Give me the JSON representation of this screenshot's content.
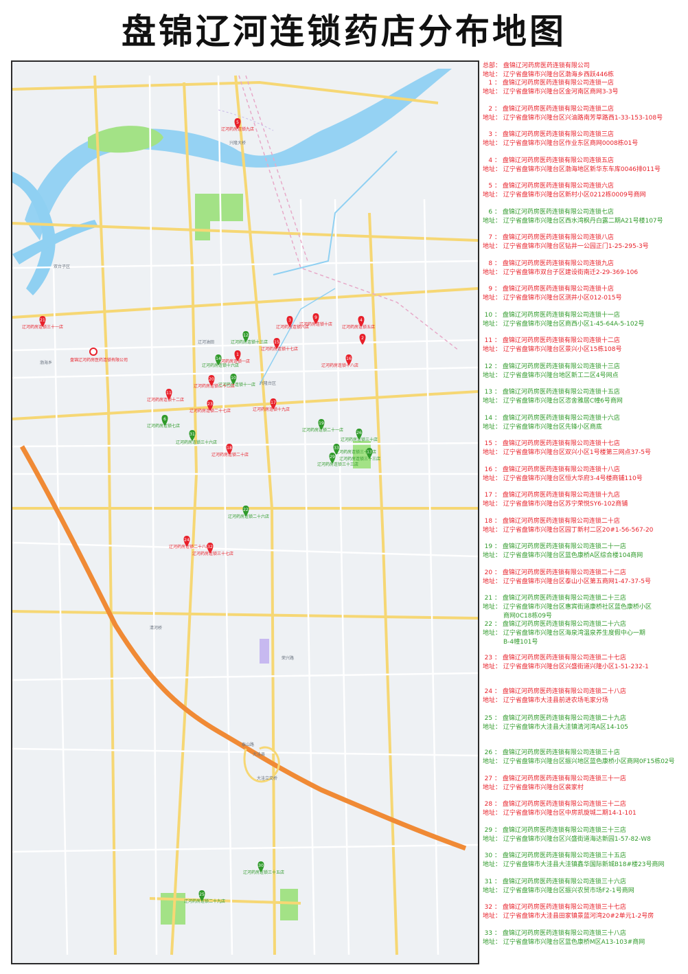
{
  "title": "盘锦辽河连锁药店分布地图",
  "colors": {
    "red": "#e8202a",
    "green": "#2f9a2a",
    "water": "#7fc8ee",
    "park": "#9fe07a",
    "road_yellow": "#f6d774",
    "highway": "#f08a35"
  },
  "addr_prefix": "地址：",
  "legend": [
    {
      "num": "总部",
      "company": "盘锦辽河药房医药连锁有限公司",
      "address": "辽宁省盘锦市兴隆台区渤海乡西跃446栋",
      "color": "red"
    },
    {
      "num": "1",
      "company": "盘锦辽河药房医药连锁有限公司连锁一店",
      "address": "辽宁省盘锦市兴隆台区金河南区商网3-3号",
      "color": "red"
    },
    {
      "num": "2",
      "company": "盘锦辽河药房医药连锁有限公司连锁二店",
      "address": "辽宁省盘锦市兴隆台区兴油路南芳草路西1-33-153-108号",
      "color": "red"
    },
    {
      "num": "3",
      "company": "盘锦辽河药房医药连锁有限公司连锁三店",
      "address": "辽宁省盘锦市兴隆台区作业东区商网0008栋01号",
      "color": "red"
    },
    {
      "num": "4",
      "company": "盘锦辽河药房医药连锁有限公司连锁五店",
      "address": "辽宁省盘锦市兴隆台区渤海地区新华东车库0046排011号",
      "color": "red"
    },
    {
      "num": "5",
      "company": "盘锦辽河药房医药连锁有限公司连锁六店",
      "address": "辽宁省盘锦市兴隆台区新村小区0212栋0009号商网",
      "color": "red"
    },
    {
      "num": "6",
      "company": "盘锦辽河药房医药连锁有限公司连锁七店",
      "address": "辽宁省盘锦市兴隆台区西水湾枫丹白露二期A21号楼107号",
      "color": "green"
    },
    {
      "num": "7",
      "company": "盘锦辽河药房医药连锁有限公司连锁八店",
      "address": "辽宁省盘锦市兴隆台区钻井一公园正门1-25-295-3号",
      "color": "red"
    },
    {
      "num": "8",
      "company": "盘锦辽河药房医药连锁有限公司连锁九店",
      "address": "辽宁省盘锦市双台子区建设街南迁2-29-369-106",
      "color": "red"
    },
    {
      "num": "9",
      "company": "盘锦辽河药房医药连锁有限公司连锁十店",
      "address": "辽宁省盘锦市兴隆台区测井小区012-015号",
      "color": "red"
    },
    {
      "num": "10",
      "company": "盘锦辽河药房医药连锁有限公司连锁十一店",
      "address": "辽宁省盘锦市兴隆台区商西小区1-45-64A-5-102号",
      "color": "green"
    },
    {
      "num": "11",
      "company": "盘锦辽河药房医药连锁有限公司连锁十二店",
      "address": "辽宁省盘锦市兴隆台区景兴小区15栋108号",
      "color": "red"
    },
    {
      "num": "12",
      "company": "盘锦辽河药房医药连锁有限公司连锁十三店",
      "address": "辽宁省盘锦市兴隆台地区新工二区4号网点",
      "color": "green"
    },
    {
      "num": "13",
      "company": "盘锦辽河药房医药连锁有限公司连锁十五店",
      "address": "辽宁省盘锦市兴隆台区恣舍雅居C幢6号商网",
      "color": "green"
    },
    {
      "num": "14",
      "company": "盘锦辽河药房医药连锁有限公司连锁十六店",
      "address": "辽宁省盘锦市兴隆台区先锋小区商底",
      "color": "green"
    },
    {
      "num": "15",
      "company": "盘锦辽河药房医药连锁有限公司连锁十七店",
      "address": "辽宁省盘锦市兴隆台区双兴小区1号楼第三网点37-5号",
      "color": "red"
    },
    {
      "num": "16",
      "company": "盘锦辽河药房医药连锁有限公司连锁十八店",
      "address": "辽宁省盘锦市兴隆台区恒大华府3-4号楼商铺110号",
      "color": "red"
    },
    {
      "num": "17",
      "company": "盘锦辽河药房医药连锁有限公司连锁十九店",
      "address": "辽宁省盘锦市兴隆台区苏宁荣悦SY6-102商铺",
      "color": "red"
    },
    {
      "num": "18",
      "company": "盘锦辽河药房医药连锁有限公司连锁二十店",
      "address": "辽宁省盘锦市兴隆台区园丁新村二区20#1-56-567-20",
      "color": "red"
    },
    {
      "num": "19",
      "company": "盘锦辽河药房医药连锁有限公司连锁二十一店",
      "address": "辽宁省盘锦市兴隆台区蓝色康桥A区综合楼104商网",
      "color": "green"
    },
    {
      "num": "20",
      "company": "盘锦辽河药房医药连锁有限公司连锁二十二店",
      "address": "辽宁省盘锦市兴隆台区泰山小区第五商网1-47-37-5号",
      "color": "red"
    },
    {
      "num": "21",
      "company": "盘锦辽河药房医药连锁有限公司连锁二十三店",
      "address": "辽宁省盘锦市兴隆台区惠宾街道康桥社区蓝色康桥小区",
      "address2": "商网0C18栋09号",
      "color": "green"
    },
    {
      "num": "22",
      "company": "盘锦辽河药房医药连锁有限公司连锁二十六店",
      "address": "辽宁省盘锦市兴隆台区海泉湾温泉养生度假中心一期",
      "address2": "B-4幢101号",
      "color": "green"
    },
    {
      "num": "23",
      "company": "盘锦辽河药房医药连锁有限公司连锁二十七店",
      "address": "辽宁省盘锦市兴隆台区兴盛街道兴隆小区1-51-232-1",
      "color": "red"
    },
    {
      "num": "24",
      "company": "盘锦辽河药房医药连锁有限公司连锁二十八店",
      "address": "辽宁省盘锦市大洼县前进农场毛家分场",
      "color": "red"
    },
    {
      "num": "25",
      "company": "盘锦辽河药房医药连锁有限公司连锁二十九店",
      "address": "辽宁省盘锦市大洼县大洼镇清河湾A区14-105",
      "color": "green"
    },
    {
      "num": "26",
      "company": "盘锦辽河药房医药连锁有限公司连锁三十店",
      "address": "辽宁省盘锦市兴隆台区振兴地区蓝色康桥小区商网0F15栋02号",
      "color": "green"
    },
    {
      "num": "27",
      "company": "盘锦辽河药房医药连锁有限公司连锁三十一店",
      "address": "辽宁省盘锦市兴隆台区裴家村",
      "color": "red"
    },
    {
      "num": "28",
      "company": "盘锦辽河药房医药连锁有限公司连锁三十二店",
      "address": "辽宁省盘锦市兴隆台区中房凯旋城二期14-1-101",
      "color": "red"
    },
    {
      "num": "29",
      "company": "盘锦辽河药房医药连锁有限公司连锁三十三店",
      "address": "辽宁省盘锦市兴隆台区兴盛街道海达新园1-57-82-W8",
      "color": "green"
    },
    {
      "num": "30",
      "company": "盘锦辽河药房医药连锁有限公司连锁三十五店",
      "address": "辽宁省盘锦市大洼县大洼镇鑫华国际新城B18#楼23号商网",
      "color": "green"
    },
    {
      "num": "31",
      "company": "盘锦辽河药房医药连锁有限公司连锁三十六店",
      "address": "辽宁省盘锦市兴隆台区振兴农贸市场F2-1号商网",
      "color": "green"
    },
    {
      "num": "32",
      "company": "盘锦辽河药房医药连锁有限公司连锁三十七店",
      "address": "辽宁省盘锦市大洼县田家镇景蓝河湾20#2单元1-2号房",
      "color": "red"
    },
    {
      "num": "33",
      "company": "盘锦辽河药房医药连锁有限公司连锁三十八店",
      "address": "辽宁省盘锦市兴隆台区蓝色康桥M区A13-103#商网",
      "color": "green"
    }
  ],
  "map": {
    "hq_label": "盘锦辽河药房医药连锁有限公司",
    "markers": [
      {
        "id": "5",
        "color": "red",
        "label": "辽河药房连锁九店"
      },
      {
        "id": "21",
        "color": "red",
        "label": "辽河药房连锁三十一店"
      },
      {
        "id": "9",
        "color": "red",
        "label": "辽河药房连锁十店"
      },
      {
        "id": "4",
        "color": "red",
        "label": "辽河药房连锁五店"
      },
      {
        "id": "3",
        "color": "red",
        "label": "辽河药房连锁六店"
      },
      {
        "id": "12",
        "color": "green",
        "label": "辽河药房连锁十三店"
      },
      {
        "id": "15",
        "color": "red",
        "label": "辽河药房连锁十七店"
      },
      {
        "id": "2",
        "color": "red",
        "label": ""
      },
      {
        "id": "16",
        "color": "red",
        "label": "辽河药房连锁十八店"
      },
      {
        "id": "1",
        "color": "red",
        "label": "辽河药房连锁一店"
      },
      {
        "id": "14",
        "color": "green",
        "label": "辽河药房连锁十六店"
      },
      {
        "id": "10",
        "color": "green",
        "label": "辽河药房连锁十一店"
      },
      {
        "id": "20",
        "color": "red",
        "label": "辽河药房连锁二十二店"
      },
      {
        "id": "11",
        "color": "red",
        "label": "辽河药房连锁十二店"
      },
      {
        "id": "23",
        "color": "red",
        "label": "辽河药房连锁二十七店"
      },
      {
        "id": "17",
        "color": "red",
        "label": "辽河药房连锁十九店"
      },
      {
        "id": "6",
        "color": "green",
        "label": "辽河药房连锁七店"
      },
      {
        "id": "19",
        "color": "green",
        "label": "辽河药房连锁二十一店"
      },
      {
        "id": "26",
        "color": "green",
        "label": "辽河药房连锁三十店"
      },
      {
        "id": "13",
        "color": "green",
        "label": "辽河药房连锁三十三店"
      },
      {
        "id": "29",
        "color": "green",
        "label": "辽河药房连锁三十三店"
      },
      {
        "id": "33",
        "color": "green",
        "label": "辽河药房连锁三十八店"
      },
      {
        "id": "31",
        "color": "green",
        "label": "辽河药房连锁三十六店"
      },
      {
        "id": "18",
        "color": "red",
        "label": "辽河药房连锁二十店"
      },
      {
        "id": "22",
        "color": "green",
        "label": "辽河药房连锁二十六店"
      },
      {
        "id": "24",
        "color": "red",
        "label": "辽河药房连锁二十八店"
      },
      {
        "id": "32",
        "color": "red",
        "label": "辽河药房连锁三十七店"
      },
      {
        "id": "30",
        "color": "green",
        "label": "辽河药房连锁三十五店"
      },
      {
        "id": "25",
        "color": "green",
        "label": "辽河药房连锁二十九店"
      }
    ],
    "place_labels": [
      "兴隆大桥",
      "双台子区",
      "渤海乡",
      "辽河油田",
      "兴隆台区",
      "大洼县",
      "大洼立交桥",
      "清河桥",
      "泰山路",
      "荣兴路"
    ]
  }
}
